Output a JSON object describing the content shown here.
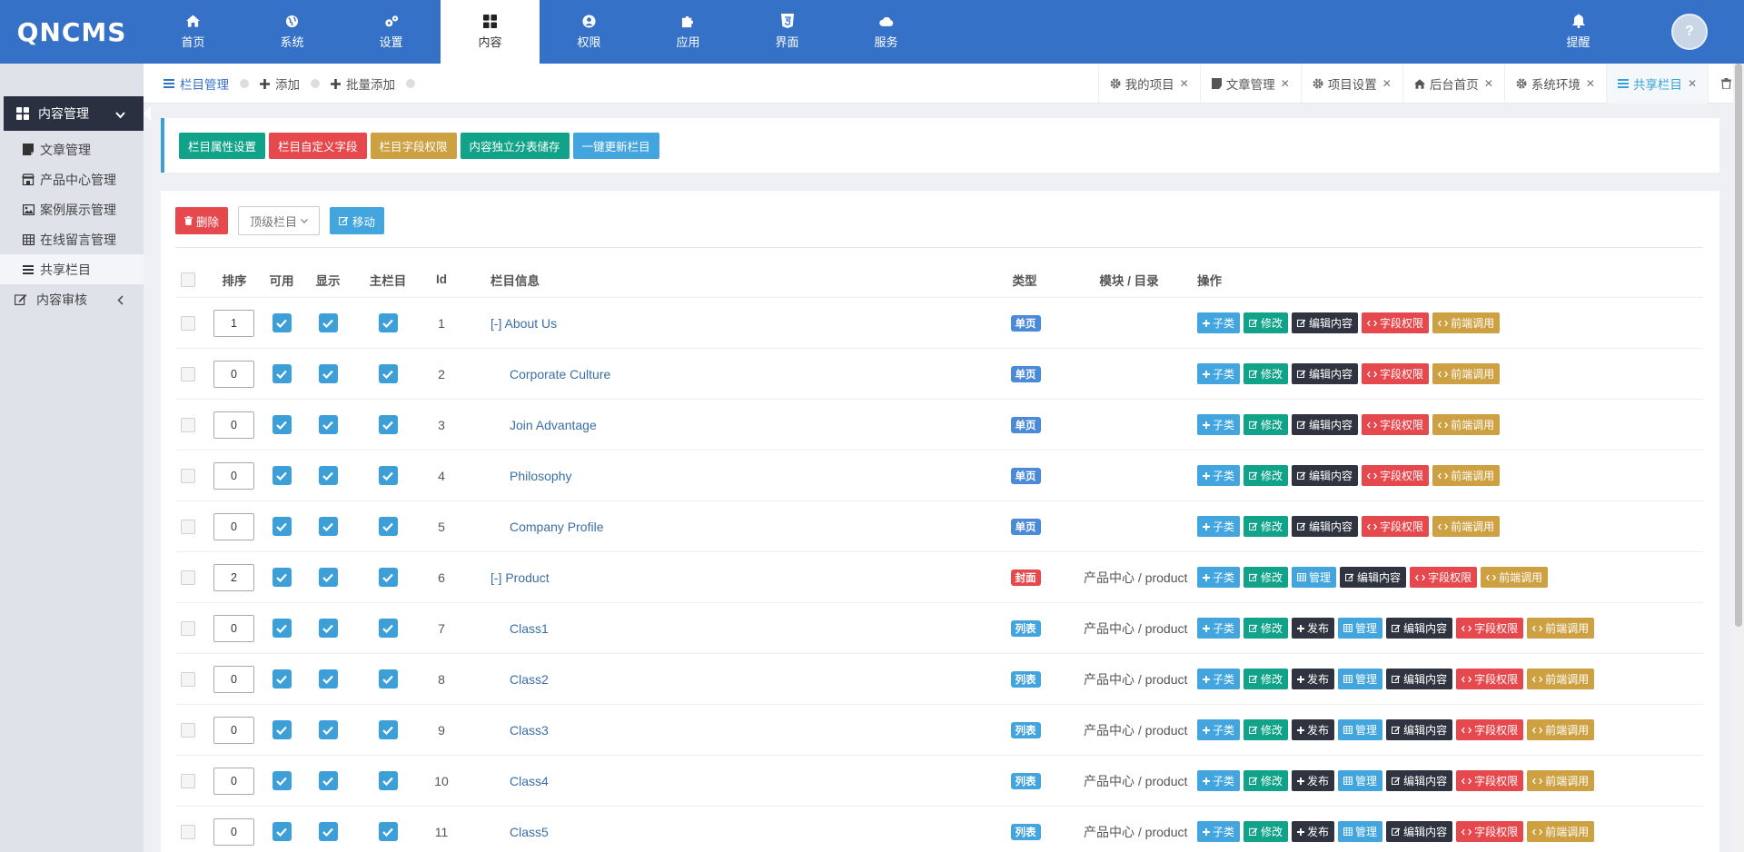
{
  "app": {
    "logo": "QNCMS"
  },
  "topnav": {
    "items": [
      {
        "label": "首页",
        "icon": "home-icon"
      },
      {
        "label": "系统",
        "icon": "globe-icon"
      },
      {
        "label": "设置",
        "icon": "gears-icon"
      },
      {
        "label": "内容",
        "icon": "grid-icon",
        "active": true
      },
      {
        "label": "权限",
        "icon": "user-icon"
      },
      {
        "label": "应用",
        "icon": "puzzle-icon"
      },
      {
        "label": "界面",
        "icon": "html5-icon"
      },
      {
        "label": "服务",
        "icon": "cloud-icon"
      }
    ],
    "bell_label": "提醒",
    "avatar_text": "?"
  },
  "sidebar": {
    "section": "内容管理",
    "items": [
      "文章管理",
      "产品中心管理",
      "案例展示管理",
      "在线留言管理",
      "共享栏目"
    ],
    "group": "内容审核"
  },
  "breadcrumbs": [
    "栏目管理",
    "添加",
    "批量添加"
  ],
  "tabs": [
    "我的项目",
    "文章管理",
    "项目设置",
    "后台首页",
    "系统环境",
    "共享栏目"
  ],
  "quick_buttons": [
    "栏目属性设置",
    "栏目自定义字段",
    "栏目字段权限",
    "内容独立分表储存",
    "一键更新栏目"
  ],
  "toolbar": {
    "delete": "删除",
    "select": "顶级栏目",
    "move": "移动"
  },
  "table": {
    "headers": {
      "sort": "排序",
      "enabled": "可用",
      "show": "显示",
      "main": "主栏目",
      "id": "Id",
      "info": "栏目信息",
      "type": "类型",
      "module": "模块 / 目录",
      "ops": "操作"
    },
    "ops_labels": {
      "sub": "子类",
      "edit": "修改",
      "publish": "发布",
      "manage": "管理",
      "editc": "编辑内容",
      "field": "字段权限",
      "front": "前端调用"
    },
    "rows": [
      {
        "sort": "1",
        "id": "1",
        "name": "[-] About Us",
        "level": 0,
        "type": "单页",
        "module": "",
        "ops": [
          "sub",
          "edit",
          "editc",
          "field",
          "front"
        ]
      },
      {
        "sort": "0",
        "id": "2",
        "name": "Corporate Culture",
        "level": 1,
        "type": "单页",
        "module": "",
        "ops": [
          "sub",
          "edit",
          "editc",
          "field",
          "front"
        ]
      },
      {
        "sort": "0",
        "id": "3",
        "name": "Join Advantage",
        "level": 1,
        "type": "单页",
        "module": "",
        "ops": [
          "sub",
          "edit",
          "editc",
          "field",
          "front"
        ]
      },
      {
        "sort": "0",
        "id": "4",
        "name": "Philosophy",
        "level": 1,
        "type": "单页",
        "module": "",
        "ops": [
          "sub",
          "edit",
          "editc",
          "field",
          "front"
        ]
      },
      {
        "sort": "0",
        "id": "5",
        "name": "Company Profile",
        "level": 1,
        "type": "单页",
        "module": "",
        "ops": [
          "sub",
          "edit",
          "editc",
          "field",
          "front"
        ]
      },
      {
        "sort": "2",
        "id": "6",
        "name": "[-] Product",
        "level": 0,
        "type": "封面",
        "module": "产品中心 / product",
        "ops": [
          "sub",
          "edit",
          "manage",
          "editc",
          "field",
          "front"
        ]
      },
      {
        "sort": "0",
        "id": "7",
        "name": "Class1",
        "level": 1,
        "type": "列表",
        "module": "产品中心 / product",
        "ops": [
          "sub",
          "edit",
          "publish",
          "manage",
          "editc",
          "field",
          "front"
        ]
      },
      {
        "sort": "0",
        "id": "8",
        "name": "Class2",
        "level": 1,
        "type": "列表",
        "module": "产品中心 / product",
        "ops": [
          "sub",
          "edit",
          "publish",
          "manage",
          "editc",
          "field",
          "front"
        ]
      },
      {
        "sort": "0",
        "id": "9",
        "name": "Class3",
        "level": 1,
        "type": "列表",
        "module": "产品中心 / product",
        "ops": [
          "sub",
          "edit",
          "publish",
          "manage",
          "editc",
          "field",
          "front"
        ]
      },
      {
        "sort": "0",
        "id": "10",
        "name": "Class4",
        "level": 1,
        "type": "列表",
        "module": "产品中心 / product",
        "ops": [
          "sub",
          "edit",
          "publish",
          "manage",
          "editc",
          "field",
          "front"
        ]
      },
      {
        "sort": "0",
        "id": "11",
        "name": "Class5",
        "level": 1,
        "type": "列表",
        "module": "产品中心 / product",
        "ops": [
          "sub",
          "edit",
          "publish",
          "manage",
          "editc",
          "field",
          "front"
        ]
      }
    ]
  }
}
